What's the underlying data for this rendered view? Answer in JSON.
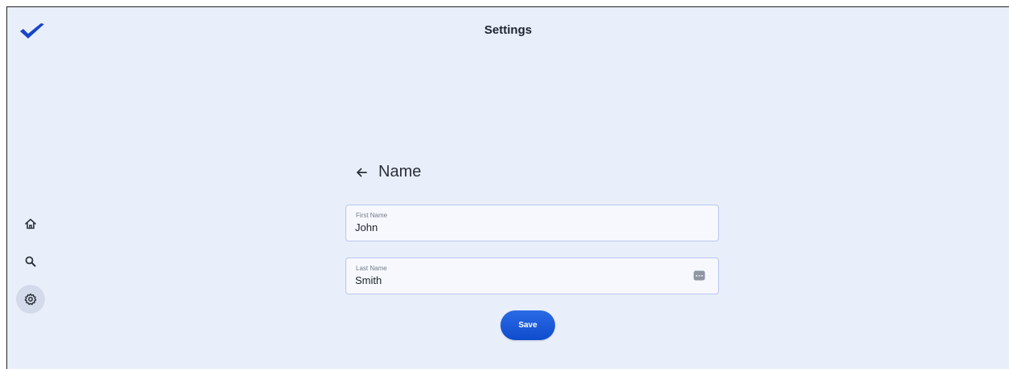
{
  "header": {
    "title": "Settings",
    "logo_icon": "checkmark-logo-icon",
    "brand_color": "#1746c8"
  },
  "sidebar": {
    "items": [
      {
        "icon": "home-icon",
        "active": false
      },
      {
        "icon": "search-icon",
        "active": false
      },
      {
        "icon": "gear-icon",
        "active": true
      }
    ]
  },
  "section": {
    "back_icon": "arrow-left-icon",
    "title": "Name"
  },
  "form": {
    "first_name": {
      "label": "First Name",
      "value": "John"
    },
    "last_name": {
      "label": "Last Name",
      "value": "Smith",
      "trailing_icon": "keyboard-icon"
    },
    "save_label": "Save",
    "save_color": "#1554d8"
  }
}
